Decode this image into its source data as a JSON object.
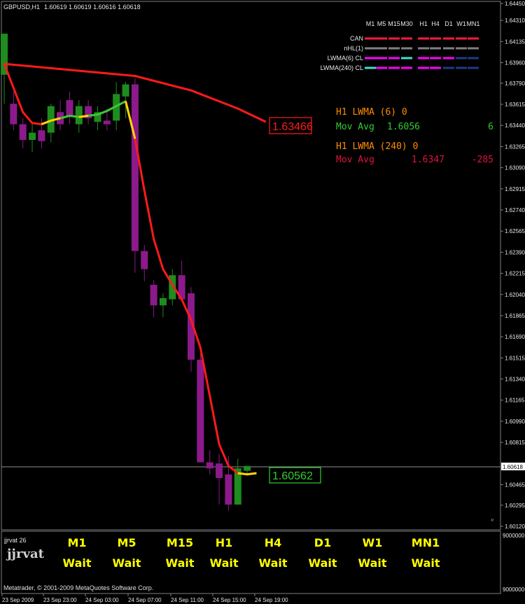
{
  "header": {
    "symbol_tf": "GBPUSD,H1",
    "ohlc": "1.60619 1.60619 1.60616 1.60618"
  },
  "legend": {
    "timeframes": [
      "M1",
      "M5",
      "M15",
      "M30",
      "H1",
      "H4",
      "D1",
      "W1",
      "MN1"
    ],
    "rows": [
      {
        "label": "CAN",
        "colors": [
          "#ff1a40",
          "#ff1a40",
          "#ff1a40",
          "#ff1a40",
          "#ff1a40",
          "#ff1a40",
          "#ff1a40",
          "#ff1a40",
          "#ff1a40"
        ]
      },
      {
        "label": "nHL(1)",
        "colors": [
          "#808080",
          "#808080",
          "#808080",
          "#808080",
          "#808080",
          "#808080",
          "#808080",
          "#808080",
          "#808080"
        ]
      },
      {
        "label": "LWMA(6) CL",
        "colors": [
          "#ff00ff",
          "#ff00ff",
          "#ff00ff",
          "#40e0d0",
          "#ff00ff",
          "#ff00ff",
          "#ff00ff",
          "#1e3a8a",
          "#1e3a8a"
        ]
      },
      {
        "label": "LWMA(240) CL",
        "colors": [
          "#40e0d0",
          "#ff00ff",
          "#ff00ff",
          "#ff00ff",
          "#ff00ff",
          "#ff00ff",
          "#1e3a8a",
          "#1e3a8a",
          "#1e3a8a"
        ]
      }
    ]
  },
  "info": {
    "line1": {
      "label": "H1 LWMA (6) 0",
      "color": "#ff8c00"
    },
    "line2": {
      "label": "Mov Avg",
      "value": "1.6056",
      "extra": "6",
      "color": "#32cd32"
    },
    "line3": {
      "label": "H1 LWMA (240) 0",
      "color": "#ff8c00"
    },
    "line4": {
      "label": "Mov Avg",
      "value": "1.6347",
      "extra": "-285",
      "color": "#dc143c"
    }
  },
  "price_labels": {
    "lwma240": "1.63466",
    "lwma6": "1.60562",
    "current": "1.60618"
  },
  "chart_data": {
    "type": "candlestick",
    "symbol": "GBPUSD",
    "timeframe": "H1",
    "y_ticks": [
      "1.64450",
      "1.64310",
      "1.64135",
      "1.63960",
      "1.63790",
      "1.63615",
      "1.63440",
      "1.63265",
      "1.63090",
      "1.62915",
      "1.62740",
      "1.62565",
      "1.62390",
      "1.62215",
      "1.62040",
      "1.61865",
      "1.61690",
      "1.61515",
      "1.61340",
      "1.61165",
      "1.60990",
      "1.60815",
      "1.60465",
      "1.60295",
      "1.60120"
    ],
    "x_ticks": [
      "23 Sep 2009",
      "23 Sep 23:00",
      "24 Sep 03:00",
      "24 Sep 07:00",
      "24 Sep 11:00",
      "24 Sep 15:00",
      "24 Sep 19:00"
    ],
    "ylim": [
      1.6012,
      1.6445
    ],
    "current_price": 1.60618,
    "candles": [
      {
        "o": 1.6386,
        "h": 1.642,
        "l": 1.6362,
        "c": 1.642
      },
      {
        "o": 1.6362,
        "h": 1.6372,
        "l": 1.634,
        "c": 1.6345
      },
      {
        "o": 1.6345,
        "h": 1.635,
        "l": 1.6325,
        "c": 1.6332
      },
      {
        "o": 1.6332,
        "h": 1.6345,
        "l": 1.6322,
        "c": 1.6338
      },
      {
        "o": 1.634,
        "h": 1.635,
        "l": 1.6325,
        "c": 1.6331
      },
      {
        "o": 1.6338,
        "h": 1.6362,
        "l": 1.633,
        "c": 1.636
      },
      {
        "o": 1.6355,
        "h": 1.6365,
        "l": 1.634,
        "c": 1.6345
      },
      {
        "o": 1.6365,
        "h": 1.6372,
        "l": 1.6345,
        "c": 1.6352
      },
      {
        "o": 1.6345,
        "h": 1.6365,
        "l": 1.6338,
        "c": 1.636
      },
      {
        "o": 1.636,
        "h": 1.6365,
        "l": 1.6345,
        "c": 1.635
      },
      {
        "o": 1.6347,
        "h": 1.636,
        "l": 1.634,
        "c": 1.6355
      },
      {
        "o": 1.6348,
        "h": 1.6358,
        "l": 1.634,
        "c": 1.6345
      },
      {
        "o": 1.6348,
        "h": 1.638,
        "l": 1.634,
        "c": 1.637
      },
      {
        "o": 1.6368,
        "h": 1.638,
        "l": 1.635,
        "c": 1.6378
      },
      {
        "o": 1.6378,
        "h": 1.6383,
        "l": 1.6222,
        "c": 1.624
      },
      {
        "o": 1.624,
        "h": 1.6245,
        "l": 1.6215,
        "c": 1.6225
      },
      {
        "o": 1.6212,
        "h": 1.6216,
        "l": 1.6185,
        "c": 1.6195
      },
      {
        "o": 1.6195,
        "h": 1.6205,
        "l": 1.6185,
        "c": 1.6201
      },
      {
        "o": 1.62,
        "h": 1.6225,
        "l": 1.6195,
        "c": 1.622
      },
      {
        "o": 1.622,
        "h": 1.6232,
        "l": 1.62,
        "c": 1.62
      },
      {
        "o": 1.6205,
        "h": 1.621,
        "l": 1.614,
        "c": 1.615
      },
      {
        "o": 1.615,
        "h": 1.6155,
        "l": 1.608,
        "c": 1.6065
      },
      {
        "o": 1.6065,
        "h": 1.6075,
        "l": 1.6055,
        "c": 1.606
      },
      {
        "o": 1.6064,
        "h": 1.6072,
        "l": 1.603,
        "c": 1.6052
      },
      {
        "o": 1.6055,
        "h": 1.607,
        "l": 1.6025,
        "c": 1.603
      },
      {
        "o": 1.603,
        "h": 1.6068,
        "l": 1.603,
        "c": 1.606
      },
      {
        "o": 1.6058,
        "h": 1.6062,
        "l": 1.6054,
        "c": 1.6062
      }
    ],
    "series": [
      {
        "name": "LWMA(240)",
        "color": "#ff1a1a",
        "points": [
          [
            0,
            1.6395
          ],
          [
            14,
            1.6385
          ],
          [
            20,
            1.6373
          ],
          [
            25,
            1.6358
          ],
          [
            28,
            1.6347
          ]
        ]
      },
      {
        "name": "LWMA(6)",
        "color": "#ff1a1a",
        "points": [
          [
            0,
            1.6395
          ],
          [
            1,
            1.6375
          ],
          [
            2,
            1.6355
          ],
          [
            3,
            1.6346
          ],
          [
            4,
            1.6345
          ],
          [
            5,
            1.6348
          ],
          [
            6,
            1.635
          ],
          [
            7,
            1.6352
          ],
          [
            8,
            1.6351
          ],
          [
            9,
            1.6352
          ],
          [
            10,
            1.6353
          ],
          [
            11,
            1.6356
          ],
          [
            12,
            1.636
          ],
          [
            13,
            1.6364
          ],
          [
            14,
            1.6333
          ],
          [
            15,
            1.629
          ],
          [
            16,
            1.625
          ],
          [
            17,
            1.6225
          ],
          [
            18,
            1.6212
          ],
          [
            19,
            1.62
          ],
          [
            20,
            1.6183
          ],
          [
            21,
            1.616
          ],
          [
            22,
            1.612
          ],
          [
            23,
            1.608
          ],
          [
            24,
            1.6062
          ],
          [
            25,
            1.6056
          ],
          [
            26,
            1.6055
          ],
          [
            27,
            1.6056
          ]
        ]
      }
    ]
  },
  "bottom_panel": {
    "name": "jjrvat 26",
    "brand": "jjrvat",
    "timeframes": [
      "M1",
      "M5",
      "M15",
      "H1",
      "H4",
      "D1",
      "W1",
      "MN1"
    ],
    "status": [
      "Wait",
      "Wait",
      "Wait",
      "Wait",
      "Wait",
      "Wait",
      "Wait",
      "Wait"
    ],
    "scale_top": "9000000",
    "scale_bottom": "9000000",
    "copyright": "Metatrader, © 2001-2009 MetaQuotes Software Corp."
  }
}
